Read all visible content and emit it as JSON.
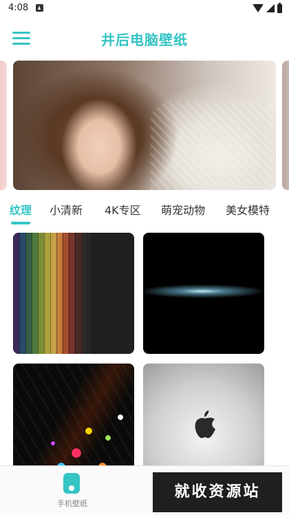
{
  "status_bar": {
    "time": "4:08"
  },
  "app_bar": {
    "title": "井后电脑壁纸"
  },
  "categories": [
    "纹理",
    "小清新",
    "4K专区",
    "萌宠动物",
    "美女模特"
  ],
  "bottom_nav": {
    "items": [
      {
        "label": "手机壁纸",
        "icon": "phone-icon",
        "active": true
      }
    ]
  },
  "watermark": "就收资源站",
  "colors": {
    "accent": "#35c4c4"
  }
}
